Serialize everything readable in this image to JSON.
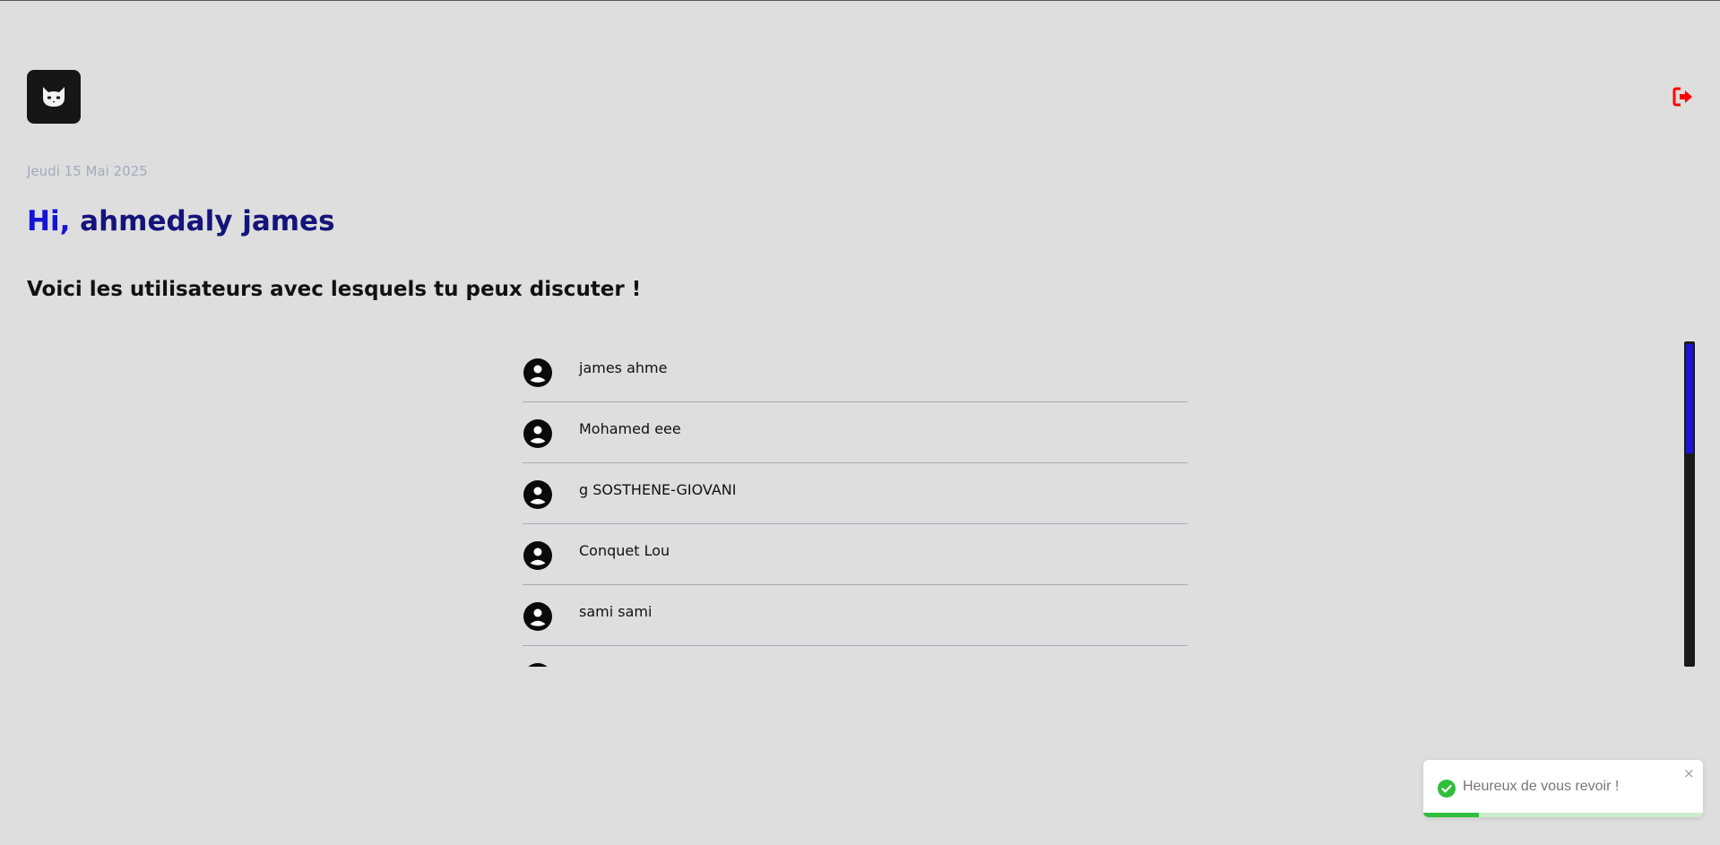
{
  "header": {
    "logo_icon": "cat-face-icon",
    "logout_icon": "logout-icon",
    "logout_color": "#ff0000"
  },
  "welcome": {
    "date": "Jeudi 15 Mai 2025",
    "greeting_prefix": "Hi,",
    "greeting_name": "ahmedaly james",
    "subtitle": "Voici les utilisateurs avec lesquels tu peux discuter !"
  },
  "users": [
    {
      "name": "james ahme"
    },
    {
      "name": "Mohamed eee"
    },
    {
      "name": "g SOSTHENE-GIOVANI"
    },
    {
      "name": "Conquet Lou"
    },
    {
      "name": "sami sami"
    },
    {
      "name": ""
    }
  ],
  "user_avatar_icon": "user-avatar-icon",
  "scroll": {
    "position_fraction": 0.0,
    "visible_fraction": 0.34,
    "thumb_color": "#1a15d8"
  },
  "toast": {
    "message": "Heureux de vous revoir !",
    "status_icon": "check-circle-icon",
    "close_glyph": "×",
    "progress_fraction": 0.2,
    "accent_color": "#2fbf3b"
  }
}
